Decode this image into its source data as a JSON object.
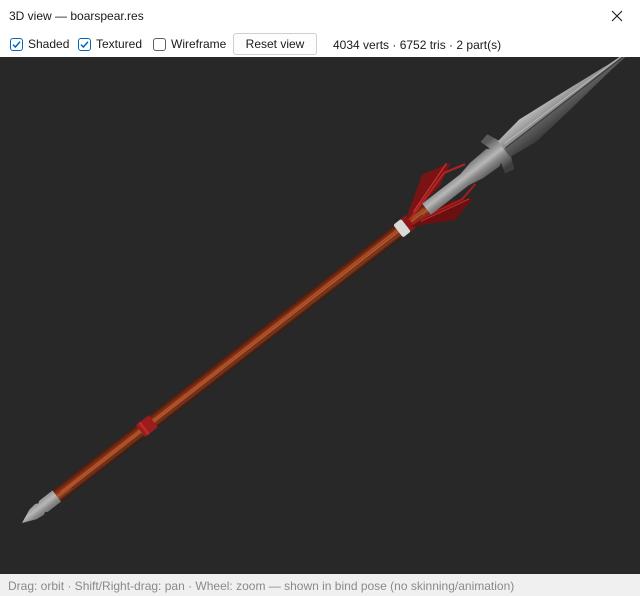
{
  "window": {
    "title": "3D view — boarspear.res",
    "close_icon": "close-icon"
  },
  "toolbar": {
    "checkboxes": [
      {
        "label": "Shaded",
        "checked": true
      },
      {
        "label": "Textured",
        "checked": true
      },
      {
        "label": "Wireframe",
        "checked": false
      }
    ],
    "reset_label": "Reset view",
    "stats": "4034 verts · 6752 tris · 2 part(s)"
  },
  "viewport": {
    "background": "#282828",
    "model": "boar spear",
    "colors": {
      "shaft": "#8a3418",
      "metal": "#9a9a9a",
      "binding": "#9c1c1c"
    }
  },
  "status": {
    "hint": "Drag: orbit · Shift/Right-drag: pan · Wheel: zoom — shown in bind pose (no skinning/animation)"
  }
}
